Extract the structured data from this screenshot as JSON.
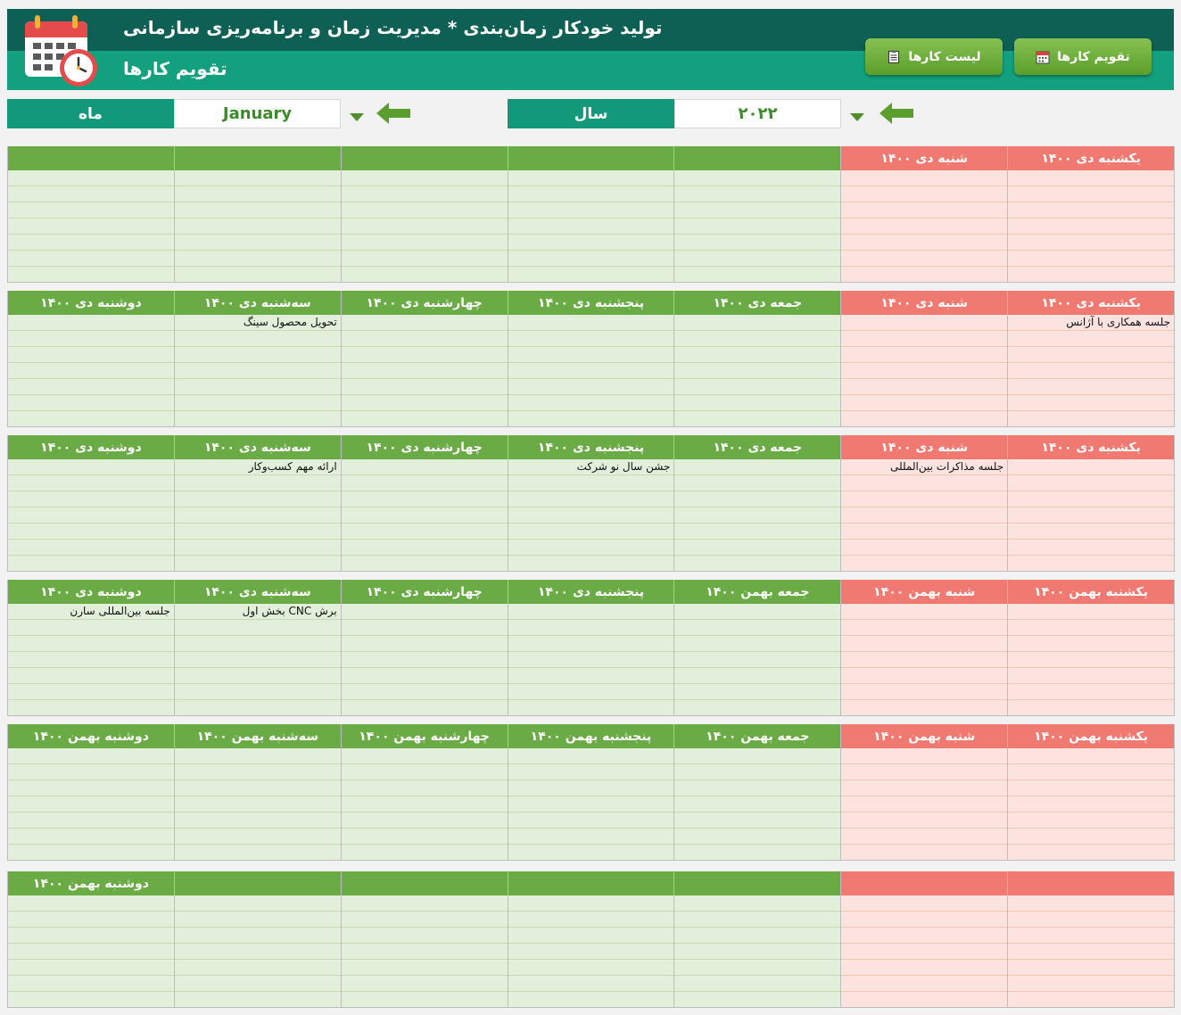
{
  "header": {
    "title": "تولید خودکار زمان‌بندی * مدیریت زمان و برنامه‌ریزی سازمانی",
    "subtitle": "تقویم کارها"
  },
  "nav": {
    "calendar_button": "تقویم کارها",
    "list_button": "لیست کارها"
  },
  "controls": {
    "month_label": "ماه",
    "month_value": "January",
    "year_label": "سال",
    "year_value": "۲۰۲۲"
  },
  "colors": {
    "header_dark": "#0e5f54",
    "header_teal": "#13a07e",
    "workday_head": "#6aab46",
    "weekend_head": "#f07a72",
    "workday_cell": "#e2efda",
    "weekend_cell": "#fde3e0"
  },
  "weeks": [
    {
      "days": [
        {
          "label": "",
          "events": []
        },
        {
          "label": "",
          "events": []
        },
        {
          "label": "",
          "events": []
        },
        {
          "label": "",
          "events": []
        },
        {
          "label": "",
          "events": []
        },
        {
          "label": "شنبه دی ۱۴۰۰",
          "weekend": true,
          "events": []
        },
        {
          "label": "یکشنبه دی ۱۴۰۰",
          "weekend": true,
          "events": []
        }
      ]
    },
    {
      "days": [
        {
          "label": "دوشنبه دی ۱۴۰۰",
          "events": []
        },
        {
          "label": "سه‌شنبه دی ۱۴۰۰",
          "events": [
            "تحویل محصول سینگ"
          ]
        },
        {
          "label": "چهارشنبه دی ۱۴۰۰",
          "events": []
        },
        {
          "label": "پنجشنبه دی ۱۴۰۰",
          "events": []
        },
        {
          "label": "جمعه دی ۱۴۰۰",
          "events": []
        },
        {
          "label": "شنبه دی ۱۴۰۰",
          "weekend": true,
          "events": []
        },
        {
          "label": "یکشنبه دی ۱۴۰۰",
          "weekend": true,
          "events": [
            "جلسه همکاری با آژانس"
          ]
        }
      ]
    },
    {
      "days": [
        {
          "label": "دوشنبه دی ۱۴۰۰",
          "events": []
        },
        {
          "label": "سه‌شنبه دی ۱۴۰۰",
          "events": [
            "ارائه مهم کسب‌وکار"
          ]
        },
        {
          "label": "چهارشنبه دی ۱۴۰۰",
          "events": []
        },
        {
          "label": "پنجشنبه دی ۱۴۰۰",
          "events": [
            "جشن سال نو شرکت"
          ]
        },
        {
          "label": "جمعه دی ۱۴۰۰",
          "events": []
        },
        {
          "label": "شنبه دی ۱۴۰۰",
          "weekend": true,
          "events": [
            "جلسه مذاکرات بین‌المللی"
          ]
        },
        {
          "label": "یکشنبه دی ۱۴۰۰",
          "weekend": true,
          "events": []
        }
      ]
    },
    {
      "days": [
        {
          "label": "دوشنبه دی ۱۴۰۰",
          "events": [
            "جلسه بین‌المللی سارن"
          ]
        },
        {
          "label": "سه‌شنبه دی ۱۴۰۰",
          "events": [
            "برش CNC بخش اول"
          ]
        },
        {
          "label": "چهارشنبه دی ۱۴۰۰",
          "events": []
        },
        {
          "label": "پنجشنبه دی ۱۴۰۰",
          "events": []
        },
        {
          "label": "جمعه بهمن ۱۴۰۰",
          "events": []
        },
        {
          "label": "شنبه بهمن ۱۴۰۰",
          "weekend": true,
          "events": []
        },
        {
          "label": "یکشنبه بهمن ۱۴۰۰",
          "weekend": true,
          "events": []
        }
      ]
    },
    {
      "days": [
        {
          "label": "دوشنبه بهمن ۱۴۰۰",
          "events": []
        },
        {
          "label": "سه‌شنبه بهمن ۱۴۰۰",
          "events": []
        },
        {
          "label": "چهارشنبه بهمن ۱۴۰۰",
          "events": []
        },
        {
          "label": "پنجشنبه بهمن ۱۴۰۰",
          "events": []
        },
        {
          "label": "جمعه بهمن ۱۴۰۰",
          "events": []
        },
        {
          "label": "شنبه بهمن ۱۴۰۰",
          "weekend": true,
          "events": []
        },
        {
          "label": "یکشنبه بهمن ۱۴۰۰",
          "weekend": true,
          "events": []
        }
      ]
    },
    {
      "days": [
        {
          "label": "دوشنبه بهمن ۱۴۰۰",
          "events": []
        },
        {
          "label": "",
          "events": []
        },
        {
          "label": "",
          "events": []
        },
        {
          "label": "",
          "events": []
        },
        {
          "label": "",
          "events": []
        },
        {
          "label": "",
          "weekend": true,
          "events": []
        },
        {
          "label": "",
          "weekend": true,
          "events": []
        }
      ]
    }
  ]
}
